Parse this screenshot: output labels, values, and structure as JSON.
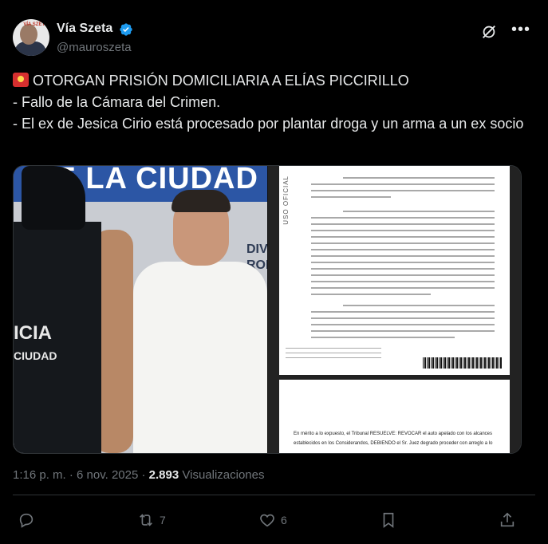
{
  "author": {
    "name": "Vía Szeta",
    "handle": "@mauroszeta",
    "avatar_label": "VÍA SZETA"
  },
  "post": {
    "headline": "OTORGAN PRISIÓN DOMICILIARIA A ELÍAS PICCIRILLO",
    "line2": "- Fallo de la Cámara del Crimen.",
    "line3": "- El ex de Jesica Cirio está procesado por plantar droga y un arma a un ex socio"
  },
  "media": {
    "photo": {
      "wall_text": "DE LA CIUDAD",
      "wall_sign": "DIV ROBOS N",
      "vest_text_1": "ICIA",
      "vest_text_2": "CIUDAD"
    },
    "document": {
      "side_label": "USO OFICIAL",
      "page2_text": "En mérito a lo expuesto, el Tribunal RESUELVE: REVOCAR el auto apelado con los alcances establecidos en los Considerandos, DEBIENDO el Sr. Juez degrado proceder con arreglo a lo"
    }
  },
  "meta": {
    "time": "1:16 p. m. · 6 nov. 2025 ·",
    "views_count": "2.893",
    "views_label": "Visualizaciones"
  },
  "actions": {
    "reply_count": "",
    "repost_count": "7",
    "like_count": "6"
  },
  "colors": {
    "accent": "#1d9bf0",
    "muted": "#71767b",
    "text": "#e7e9ea",
    "background": "#000000"
  }
}
